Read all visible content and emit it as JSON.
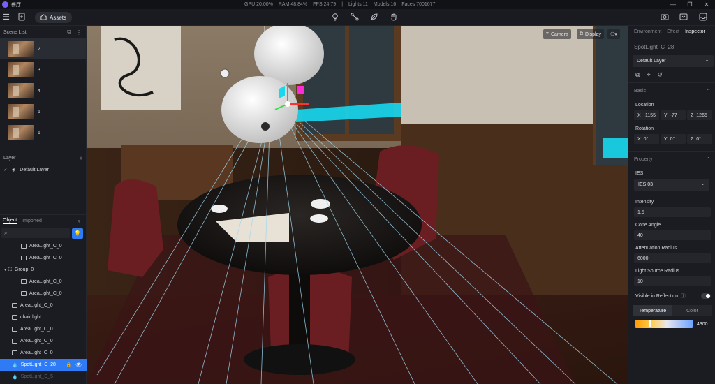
{
  "titlebar": {
    "app_name": "餐厅",
    "stats": [
      "GPU 20.00%",
      "RAM 48.84%",
      "FPS 24.79",
      "|",
      "Lights 11",
      "Models 16",
      "Faces 7001677"
    ]
  },
  "toolbar": {
    "assets_label": "Assets",
    "left_icons": [
      "menu-icon",
      "import-file-icon",
      "assets-icon"
    ],
    "center_tools": [
      "bulb-icon",
      "line-icon",
      "leaf-icon",
      "hand-icon"
    ],
    "right_icons": [
      "screenshot-icon",
      "render-icon",
      "inbox-icon"
    ]
  },
  "scene_list": {
    "title": "Scene List",
    "items": [
      {
        "label": "2",
        "selected": true
      },
      {
        "label": "3",
        "selected": false
      },
      {
        "label": "4",
        "selected": false
      },
      {
        "label": "5",
        "selected": false
      },
      {
        "label": "6",
        "selected": false
      }
    ]
  },
  "layer": {
    "title": "Layer",
    "default_layer": "Default Layer"
  },
  "object_panel": {
    "tab_object": "Object",
    "tab_imported": "Imported",
    "search_value": "",
    "tree": [
      {
        "label": "AreaLight_C_0",
        "indent": 30,
        "kind": "box"
      },
      {
        "label": "AreaLight_C_0",
        "indent": 30,
        "kind": "box"
      },
      {
        "label": "Group_0",
        "indent": 6,
        "kind": "group"
      },
      {
        "label": "AreaLight_C_0",
        "indent": 30,
        "kind": "box"
      },
      {
        "label": "AreaLight_C_0",
        "indent": 30,
        "kind": "box"
      },
      {
        "label": "AreaLight_C_0",
        "indent": 17,
        "kind": "box"
      },
      {
        "label": "chair light",
        "indent": 17,
        "kind": "box"
      },
      {
        "label": "AreaLight_C_0",
        "indent": 17,
        "kind": "box"
      },
      {
        "label": "AreaLight_C_0",
        "indent": 17,
        "kind": "box"
      },
      {
        "label": "AreaLight_C_0",
        "indent": 17,
        "kind": "box"
      },
      {
        "label": "SpotLight_C_28",
        "indent": 17,
        "kind": "spot",
        "selected": true
      },
      {
        "label": "SpotLight_C_5",
        "indent": 17,
        "kind": "spot",
        "faded": true
      }
    ]
  },
  "viewport": {
    "camera_label": "Camera",
    "display_label": "Display"
  },
  "inspector": {
    "tabs": [
      "Environment",
      "Effect",
      "Inspector"
    ],
    "active_tab": "Inspector",
    "object_name": "SpotLight_C_28",
    "layer_select": "Default Layer",
    "basic": {
      "title": "Basic",
      "location_label": "Location",
      "location": {
        "x": "-1155",
        "y": "-77",
        "z": "1265"
      },
      "rotation_label": "Rotation",
      "rotation": {
        "x": "0°",
        "y": "0°",
        "z": "0°"
      }
    },
    "property": {
      "title": "Property",
      "ies_label": "IES",
      "ies_value": "IES 03",
      "intensity_label": "Intensity",
      "intensity": "1.5",
      "cone_label": "Cone Angle",
      "cone": "40",
      "atten_label": "Attenuation Radius",
      "atten": "6000",
      "source_label": "Light Source Radius",
      "source": "10",
      "visible_label": "Visible in Reflection",
      "visible_on": true,
      "seg_temperature": "Temperature",
      "seg_color": "Color",
      "temperature": "4300",
      "temperature_level": 0.25
    }
  },
  "colors": {
    "accent": "#2f7bf5",
    "panel": "#1b1c21",
    "gizmo_pink": "#ff2bd6",
    "gizmo_cyan": "#18d8f0"
  }
}
